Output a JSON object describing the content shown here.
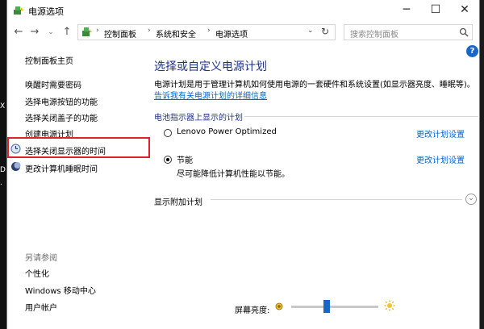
{
  "window": {
    "title": "电源选项",
    "controls": {
      "minimize": "─",
      "maximize": "☐",
      "close": "✕"
    }
  },
  "nav": {
    "back": "←",
    "forward": "→",
    "dropdown": "⌄",
    "up": "↑"
  },
  "breadcrumb": {
    "items": [
      "控制面板",
      "系统和安全",
      "电源选项"
    ],
    "separator": "›",
    "dropdown": "⌄",
    "refresh": "↻"
  },
  "search": {
    "placeholder": "搜索控制面板"
  },
  "help_label": "?",
  "sidebar": {
    "home": "控制面板主页",
    "links": [
      "唤醒时需要密码",
      "选择电源按钮的功能",
      "选择关闭盖子的功能",
      "创建电源计划",
      "选择关闭显示器的时间",
      "更改计算机睡眠时间"
    ],
    "see_also_title": "另请参阅",
    "see_also": [
      "个性化",
      "Windows 移动中心",
      "用户帐户"
    ]
  },
  "main": {
    "heading": "选择或自定义电源计划",
    "description": "电源计划是用于管理计算机如何使用电源的一套硬件和系统设置(如显示器亮度、睡眠等)。",
    "description_link": "告诉我有关电源计划的详细信息",
    "battery_group_label": "电池指示器上显示的计划",
    "plans": [
      {
        "name": "Lenovo Power Optimized",
        "subtitle": "",
        "selected": false,
        "link": "更改计划设置"
      },
      {
        "name": "节能",
        "subtitle": "尽可能降低计算机性能以节能。",
        "selected": true,
        "link": "更改计划设置"
      }
    ],
    "more_plans_label": "显示附加计划",
    "expand_glyph": "⌄"
  },
  "brightness": {
    "label": "屏幕亮度:",
    "level_percent": 40
  },
  "desktop": {
    "edge_text": [
      "X",
      "D",
      "."
    ]
  },
  "colors": {
    "heading": "#1e3287",
    "link": "#0066cc",
    "highlight_box": "#e0202a",
    "accent": "#1a66c7"
  }
}
